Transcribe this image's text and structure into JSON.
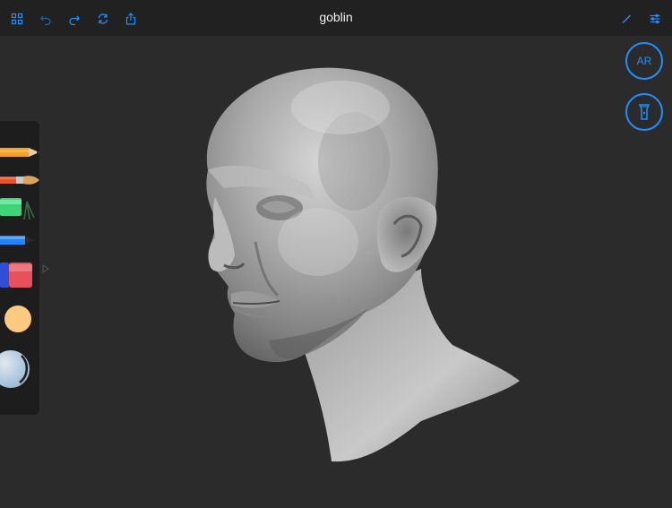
{
  "app": {
    "title": "goblin"
  },
  "toolbar": {
    "left_icons": [
      "grid-icon",
      "undo-icon",
      "redo-icon",
      "refresh-icon",
      "share-icon"
    ],
    "right_icons": [
      "pen-icon",
      "settings-icon"
    ],
    "accent": "#1e8fff"
  },
  "side_buttons": {
    "ar_label": "AR",
    "flashlight_icon": "flashlight-icon"
  },
  "tools": [
    "pencil",
    "brush",
    "marker",
    "pen",
    "eraser",
    "color-swatch",
    "color-wheel"
  ],
  "colors": {
    "background": "#2b2b2b",
    "topbar": "#212121",
    "panel": "#1d1d1d",
    "swatch": "#fbc97f"
  }
}
